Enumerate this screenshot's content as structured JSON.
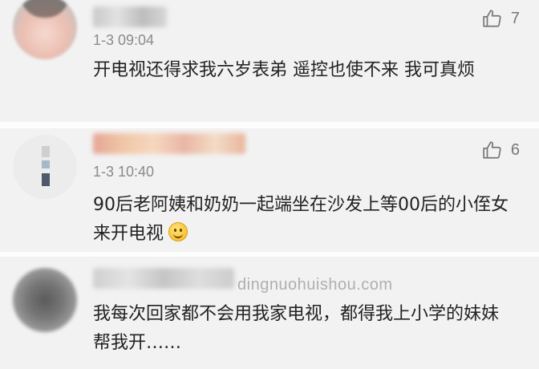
{
  "comments": [
    {
      "time": "1-3 09:04",
      "text": "开电视还得求我六岁表弟 遥控也使不来 我可真烦",
      "likes": "7"
    },
    {
      "time": "1-3 10:40",
      "text": "90后老阿姨和奶奶一起端坐在沙发上等00后的小侄女来开电视",
      "likes": "6",
      "emoji": "smile-emoji"
    },
    {
      "time": "",
      "text": "我每次回家都不会用我家电视，都得我上小学的妹妹帮我开……",
      "likes": ""
    }
  ],
  "watermark": "dingnuohuishou.com",
  "icons": {
    "like": "thumbs-up-icon"
  }
}
